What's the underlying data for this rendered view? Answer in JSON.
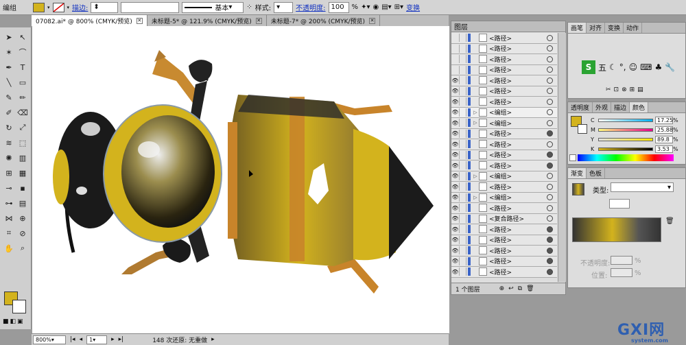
{
  "control_bar": {
    "selection_label": "编组",
    "stroke_link": "描边:",
    "stroke_style_label": "基本",
    "style_label": "样式:",
    "opacity_link": "不透明度:",
    "opacity_value": "100",
    "opacity_unit": "%",
    "transform_link": "变换",
    "fill_color": "#d3b31d"
  },
  "doc_tabs": [
    {
      "label": "07082.ai* @ 800% (CMYK/预览)",
      "active": true
    },
    {
      "label": "未标题-5* @ 121.9% (CMYK/预览)",
      "active": false
    },
    {
      "label": "未标题-7* @ 200% (CMYK/预览)",
      "active": false
    }
  ],
  "status": {
    "zoom": "800%",
    "artboard": "1",
    "message": "148 次还原: 无重做"
  },
  "layers_panel": {
    "title": "图层",
    "footer": "1 个图层",
    "rows": [
      {
        "label": "<路径>",
        "eye": false,
        "tri": false,
        "target": false
      },
      {
        "label": "<路径>",
        "eye": false,
        "tri": false,
        "target": false
      },
      {
        "label": "<路径>",
        "eye": false,
        "tri": false,
        "target": false
      },
      {
        "label": "<路径>",
        "eye": false,
        "tri": false,
        "target": false
      },
      {
        "label": "<路径>",
        "eye": true,
        "tri": false,
        "target": false
      },
      {
        "label": "<路径>",
        "eye": true,
        "tri": false,
        "target": false
      },
      {
        "label": "<路径>",
        "eye": true,
        "tri": false,
        "target": false
      },
      {
        "label": "<编组>",
        "eye": true,
        "tri": true,
        "target": false,
        "selected": true
      },
      {
        "label": "<编组>",
        "eye": true,
        "tri": true,
        "target": false
      },
      {
        "label": "<路径>",
        "eye": true,
        "tri": false,
        "target": true
      },
      {
        "label": "<路径>",
        "eye": true,
        "tri": false,
        "target": false
      },
      {
        "label": "<路径>",
        "eye": true,
        "tri": false,
        "target": true
      },
      {
        "label": "<路径>",
        "eye": true,
        "tri": false,
        "target": true
      },
      {
        "label": "<编组>",
        "eye": true,
        "tri": true,
        "target": false
      },
      {
        "label": "<路径>",
        "eye": true,
        "tri": false,
        "target": false
      },
      {
        "label": "<编组>",
        "eye": true,
        "tri": true,
        "target": false
      },
      {
        "label": "<路径>",
        "eye": true,
        "tri": false,
        "target": false
      },
      {
        "label": "<复合路径>",
        "eye": true,
        "tri": false,
        "target": false
      },
      {
        "label": "<路径>",
        "eye": true,
        "tri": false,
        "target": true
      },
      {
        "label": "<路径>",
        "eye": true,
        "tri": false,
        "target": true
      },
      {
        "label": "<路径>",
        "eye": true,
        "tri": false,
        "target": true
      },
      {
        "label": "<路径>",
        "eye": true,
        "tri": false,
        "target": true
      },
      {
        "label": "<路径>",
        "eye": true,
        "tri": false,
        "target": true
      }
    ]
  },
  "brush_panel": {
    "tabs": [
      "画笔",
      "对齐",
      "变换",
      "动作"
    ],
    "ime_text": "五"
  },
  "color_panel": {
    "tabs": [
      "透明度",
      "外观",
      "描边",
      "颜色"
    ],
    "rows": [
      {
        "label": "C",
        "value": "17.25"
      },
      {
        "label": "M",
        "value": "25.88"
      },
      {
        "label": "Y",
        "value": "89.8"
      },
      {
        "label": "K",
        "value": "3.53"
      }
    ]
  },
  "gradient_panel": {
    "tabs": [
      "渐变",
      "色板"
    ],
    "type_label": "类型:",
    "opacity_label": "不透明度:",
    "position_label": "位置:",
    "pct": "%"
  },
  "watermark": {
    "big": "GXI网",
    "small": "system.com"
  }
}
